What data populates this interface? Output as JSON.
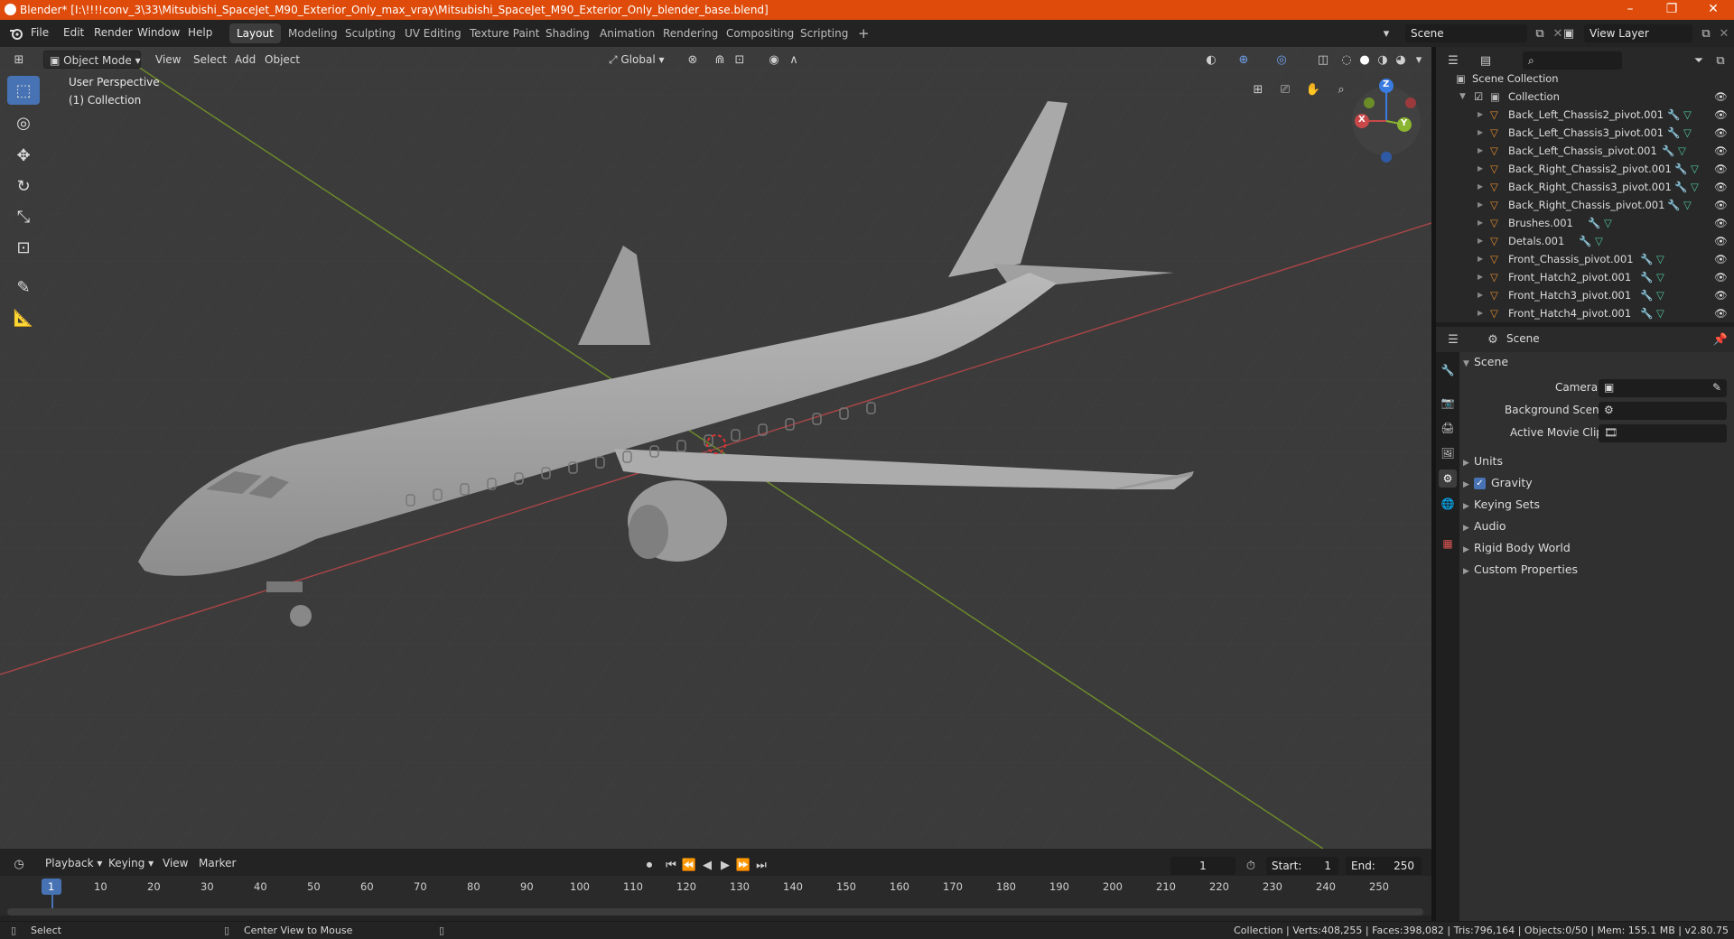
{
  "window": {
    "title": "Blender* [I:\\!!!!conv_3\\33\\Mitsubishi_SpaceJet_M90_Exterior_Only_max_vray\\Mitsubishi_SpaceJet_M90_Exterior_Only_blender_base.blend]",
    "controls": [
      "–",
      "❐",
      "✕"
    ]
  },
  "menus": [
    "File",
    "Edit",
    "Render",
    "Window",
    "Help"
  ],
  "workspaces": [
    {
      "label": "Layout",
      "active": true
    },
    {
      "label": "Modeling"
    },
    {
      "label": "Sculpting"
    },
    {
      "label": "UV Editing"
    },
    {
      "label": "Texture Paint"
    },
    {
      "label": "Shading"
    },
    {
      "label": "Animation"
    },
    {
      "label": "Rendering"
    },
    {
      "label": "Compositing"
    },
    {
      "label": "Scripting"
    }
  ],
  "add_workspace": "+",
  "scene_field": "Scene",
  "view_layer_field": "View Layer",
  "viewport_header": {
    "mode": "Object Mode",
    "menus": [
      "View",
      "Select",
      "Add",
      "Object"
    ],
    "transform_orientation": "Global"
  },
  "viewport_overlay": {
    "line1": "User Perspective",
    "line2": "(1) Collection"
  },
  "gizmo": {
    "z": "Z",
    "y": "Y",
    "x": "X"
  },
  "outliner": {
    "root": "Scene Collection",
    "collection": "Collection",
    "items": [
      "Back_Left_Chassis2_pivot.001",
      "Back_Left_Chassis3_pivot.001",
      "Back_Left_Chassis_pivot.001",
      "Back_Right_Chassis2_pivot.001",
      "Back_Right_Chassis3_pivot.001",
      "Back_Right_Chassis_pivot.001",
      "Brushes.001",
      "Detals.001",
      "Front_Chassis_pivot.001",
      "Front_Hatch2_pivot.001",
      "Front_Hatch3_pivot.001",
      "Front_Hatch4_pivot.001"
    ]
  },
  "properties": {
    "breadcrumb": "Scene",
    "panel_title": "Scene",
    "fields": [
      {
        "label": "Camera"
      },
      {
        "label": "Background Scene"
      },
      {
        "label": "Active Movie Clip"
      }
    ],
    "subpanels": [
      "Units",
      "Gravity",
      "Keying Sets",
      "Audio",
      "Rigid Body World",
      "Custom Properties"
    ]
  },
  "timeline": {
    "menus": [
      "Playback",
      "Keying",
      "View",
      "Marker"
    ],
    "current_frame": "1",
    "start_label": "Start:",
    "start": "1",
    "end_label": "End:",
    "end": "250",
    "ticks": [
      "1",
      "10",
      "20",
      "30",
      "40",
      "50",
      "60",
      "70",
      "80",
      "90",
      "100",
      "110",
      "120",
      "130",
      "140",
      "150",
      "160",
      "170",
      "180",
      "190",
      "200",
      "210",
      "220",
      "230",
      "240",
      "250"
    ]
  },
  "status": {
    "left": "Select",
    "middle": "Center View to Mouse",
    "right": "Collection | Verts:408,255 | Faces:398,082 | Tris:796,164 | Objects:0/50 | Mem: 155.1 MB | v2.80.75"
  },
  "colors": {
    "titlebar": "#de4b0a",
    "accent": "#4772b3",
    "x_axis": "#c8484a",
    "y_axis": "#8ab530",
    "z_axis": "#3a7be0",
    "object_orange": "#e08a2e"
  }
}
